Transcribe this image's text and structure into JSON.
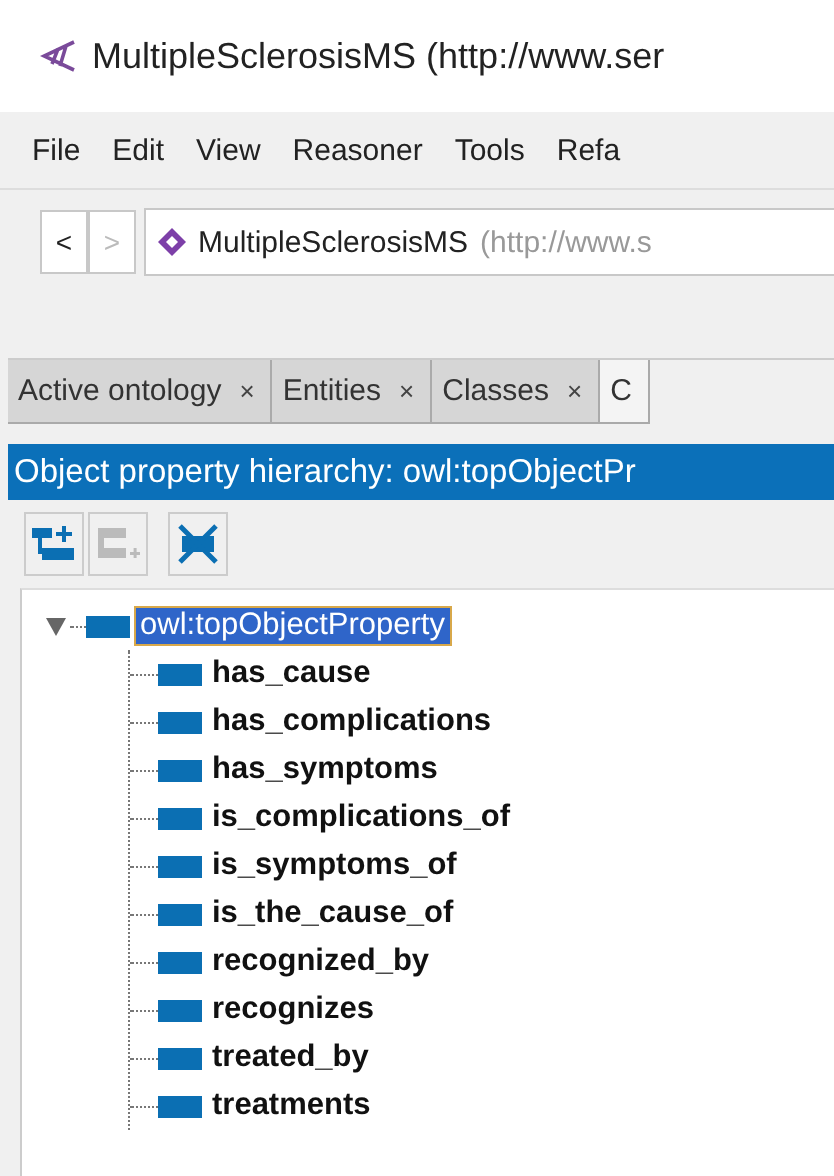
{
  "window": {
    "title": "MultipleSclerosisMS (http://www.ser"
  },
  "menu": [
    "File",
    "Edit",
    "View",
    "Reasoner",
    "Tools",
    "Refa"
  ],
  "address": {
    "back": "<",
    "forward": ">",
    "name": "MultipleSclerosisMS",
    "iri": "(http://www.s"
  },
  "tabs": [
    {
      "label": "Active ontology",
      "close": "×",
      "selected": false
    },
    {
      "label": "Entities",
      "close": "×",
      "selected": false
    },
    {
      "label": "Classes",
      "close": "×",
      "selected": false
    },
    {
      "label": "C",
      "selected": true
    }
  ],
  "panel": {
    "title": "Object property hierarchy: owl:topObjectPr",
    "toolbar": [
      {
        "kind": "add-sub",
        "disabled": false
      },
      {
        "kind": "add-sibling",
        "disabled": true
      },
      {
        "kind": "delete",
        "disabled": false
      }
    ],
    "tree": [
      {
        "label": "owl:topObjectProperty",
        "selected": true,
        "expanded": true,
        "children": [
          {
            "label": "has_cause",
            "selected": false
          },
          {
            "label": "has_complications",
            "selected": false
          },
          {
            "label": "has_symptoms",
            "selected": false
          },
          {
            "label": "is_complications_of",
            "selected": false
          },
          {
            "label": "is_symptoms_of",
            "selected": false
          },
          {
            "label": "is_the_cause_of",
            "selected": false
          },
          {
            "label": "recognized_by",
            "selected": false
          },
          {
            "label": "recognizes",
            "selected": false
          },
          {
            "label": "treated_by",
            "selected": false
          },
          {
            "label": "treatments",
            "selected": false
          }
        ]
      }
    ]
  }
}
